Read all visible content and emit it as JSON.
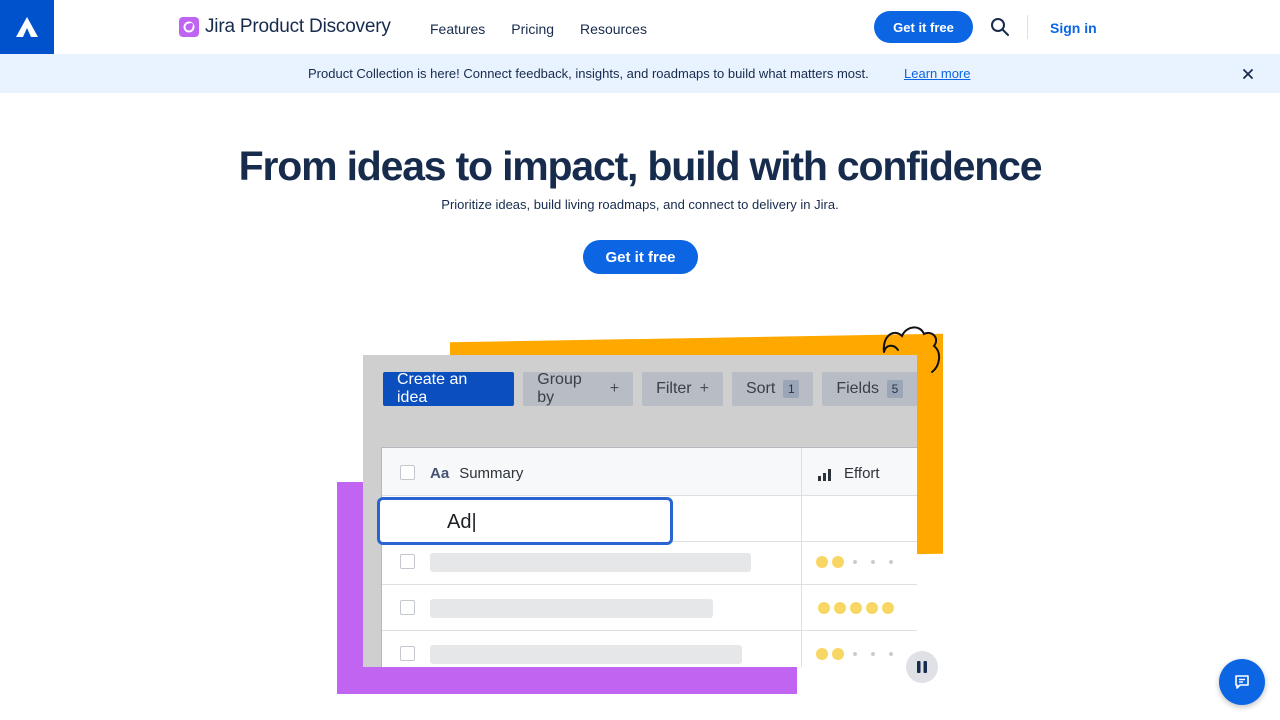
{
  "nav": {
    "brand": "Jira Product Discovery",
    "links": [
      "Features",
      "Pricing",
      "Resources"
    ],
    "cta": "Get it free",
    "sign_in": "Sign in"
  },
  "banner": {
    "text": "Product Collection is here! Connect feedback, insights, and roadmaps to build what matters most.",
    "link": "Learn more"
  },
  "hero": {
    "title": "From ideas to impact, build with confidence",
    "subtitle": "Prioritize ideas, build living roadmaps, and connect to delivery in Jira.",
    "cta": "Get it free"
  },
  "illustration": {
    "toolbar": {
      "create": "Create an idea",
      "group_by": "Group by",
      "filter": "Filter",
      "sort": "Sort",
      "sort_count": "1",
      "fields": "Fields",
      "fields_count": "5"
    },
    "table": {
      "summary_icon": "Aa",
      "summary_header": "Summary",
      "effort_header": "Effort",
      "input_value": "Ad|",
      "effort_ratings": [
        2,
        5,
        2
      ]
    }
  },
  "colors": {
    "brand_blue": "#0c66e4",
    "banner_bg": "#e9f2ff",
    "accent_yellow": "#ffa900",
    "accent_purple": "#c064f1"
  }
}
